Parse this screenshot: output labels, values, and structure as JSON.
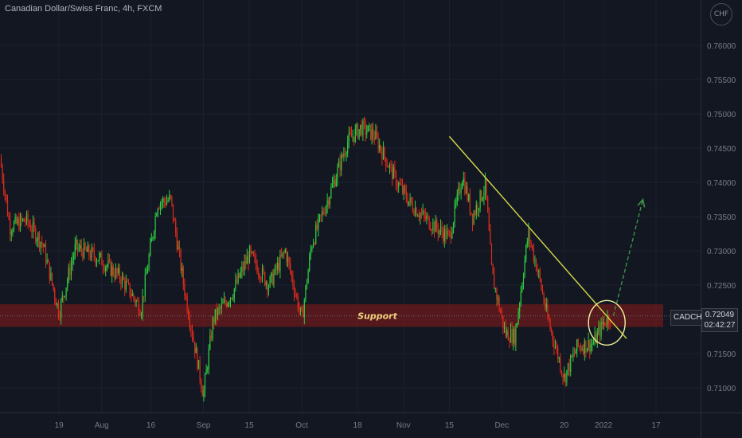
{
  "header": {
    "title": "Canadian Dollar/Swiss Franc, 4h, FXCM",
    "currency_badge": "CHF"
  },
  "price_tag": {
    "symbol": "CADCHF",
    "price": "0.72049",
    "countdown": "02:42:27"
  },
  "colors": {
    "background": "#131722",
    "up_candle": "#2ecc40",
    "down_candle": "#e02b1c",
    "support_zone": "#8b1a1a",
    "trendline": "#d4d94a",
    "circle": "#f0ef9a",
    "projection_arrow": "#3c9a48",
    "axis_text": "#787b86"
  },
  "chart_data": {
    "type": "candlestick",
    "title": "Canadian Dollar/Swiss Franc, 4h, FXCM",
    "y_axis": {
      "position": "right",
      "range": [
        0.7085,
        0.7655
      ],
      "ticks": [
        0.71,
        0.715,
        0.72,
        0.725,
        0.73,
        0.735,
        0.74,
        0.745,
        0.75,
        0.755,
        0.76
      ],
      "tick_labels": [
        "0.71000",
        "0.71500",
        "0.72000",
        "0.72500",
        "0.73000",
        "0.73500",
        "0.74000",
        "0.74500",
        "0.75000",
        "0.75500",
        "0.76000"
      ]
    },
    "x_axis": {
      "tick_labels": [
        "19",
        "Aug",
        "16",
        "Sep",
        "15",
        "Oct",
        "18",
        "Nov",
        "15",
        "Dec",
        "20",
        "2022",
        "17"
      ]
    },
    "last_price": 0.72049,
    "approx_close_path": [
      {
        "x": "Jul 1",
        "y": 0.7435
      },
      {
        "x": "Jul 4",
        "y": 0.7335
      },
      {
        "x": "Jul 9",
        "y": 0.7345
      },
      {
        "x": "Jul 14",
        "y": 0.731
      },
      {
        "x": "Jul 19",
        "y": 0.721
      },
      {
        "x": "Jul 24",
        "y": 0.7305
      },
      {
        "x": "Jul 31",
        "y": 0.729
      },
      {
        "x": "Aug 7",
        "y": 0.726
      },
      {
        "x": "Aug 13",
        "y": 0.7215
      },
      {
        "x": "Aug 18",
        "y": 0.737
      },
      {
        "x": "Aug 22",
        "y": 0.7375
      },
      {
        "x": "Aug 26",
        "y": 0.725
      },
      {
        "x": "Sep 1",
        "y": 0.709
      },
      {
        "x": "Sep 4",
        "y": 0.72
      },
      {
        "x": "Sep 10",
        "y": 0.724
      },
      {
        "x": "Sep 15",
        "y": 0.7295
      },
      {
        "x": "Sep 21",
        "y": 0.725
      },
      {
        "x": "Sep 26",
        "y": 0.73
      },
      {
        "x": "Oct 1",
        "y": 0.72
      },
      {
        "x": "Oct 4",
        "y": 0.731
      },
      {
        "x": "Oct 10",
        "y": 0.739
      },
      {
        "x": "Oct 15",
        "y": 0.746
      },
      {
        "x": "Oct 19",
        "y": 0.748
      },
      {
        "x": "Oct 23",
        "y": 0.747
      },
      {
        "x": "Oct 26",
        "y": 0.744
      },
      {
        "x": "Oct 30",
        "y": 0.74
      },
      {
        "x": "Nov 3",
        "y": 0.737
      },
      {
        "x": "Nov 7",
        "y": 0.735
      },
      {
        "x": "Nov 12",
        "y": 0.733
      },
      {
        "x": "Nov 15",
        "y": 0.732
      },
      {
        "x": "Nov 19",
        "y": 0.741
      },
      {
        "x": "Nov 22",
        "y": 0.735
      },
      {
        "x": "Nov 26",
        "y": 0.7395
      },
      {
        "x": "Nov 28",
        "y": 0.7265
      },
      {
        "x": "Dec 2",
        "y": 0.718
      },
      {
        "x": "Dec 5",
        "y": 0.7175
      },
      {
        "x": "Dec 9",
        "y": 0.7325
      },
      {
        "x": "Dec 12",
        "y": 0.727
      },
      {
        "x": "Dec 15",
        "y": 0.72
      },
      {
        "x": "Dec 20",
        "y": 0.7115
      },
      {
        "x": "Dec 24",
        "y": 0.716
      },
      {
        "x": "Dec 29",
        "y": 0.7165
      },
      {
        "x": "Jan 1",
        "y": 0.7195
      },
      {
        "x": "Jan 3",
        "y": 0.7205
      }
    ],
    "annotations": {
      "support_zone": {
        "label": "Support",
        "y_low": 0.7189,
        "y_high": 0.7222
      },
      "trendline": {
        "from": {
          "x": "Nov 15",
          "y": 0.7467
        },
        "to": {
          "x": "Jan 8",
          "y": 0.7172
        }
      },
      "circle": {
        "x": "Jan 2",
        "y": 0.7195
      },
      "projection_arrow": {
        "from": {
          "x": "Jan 4",
          "y": 0.7205
        },
        "to": {
          "x": "Jan 13",
          "y": 0.7375
        }
      }
    }
  }
}
